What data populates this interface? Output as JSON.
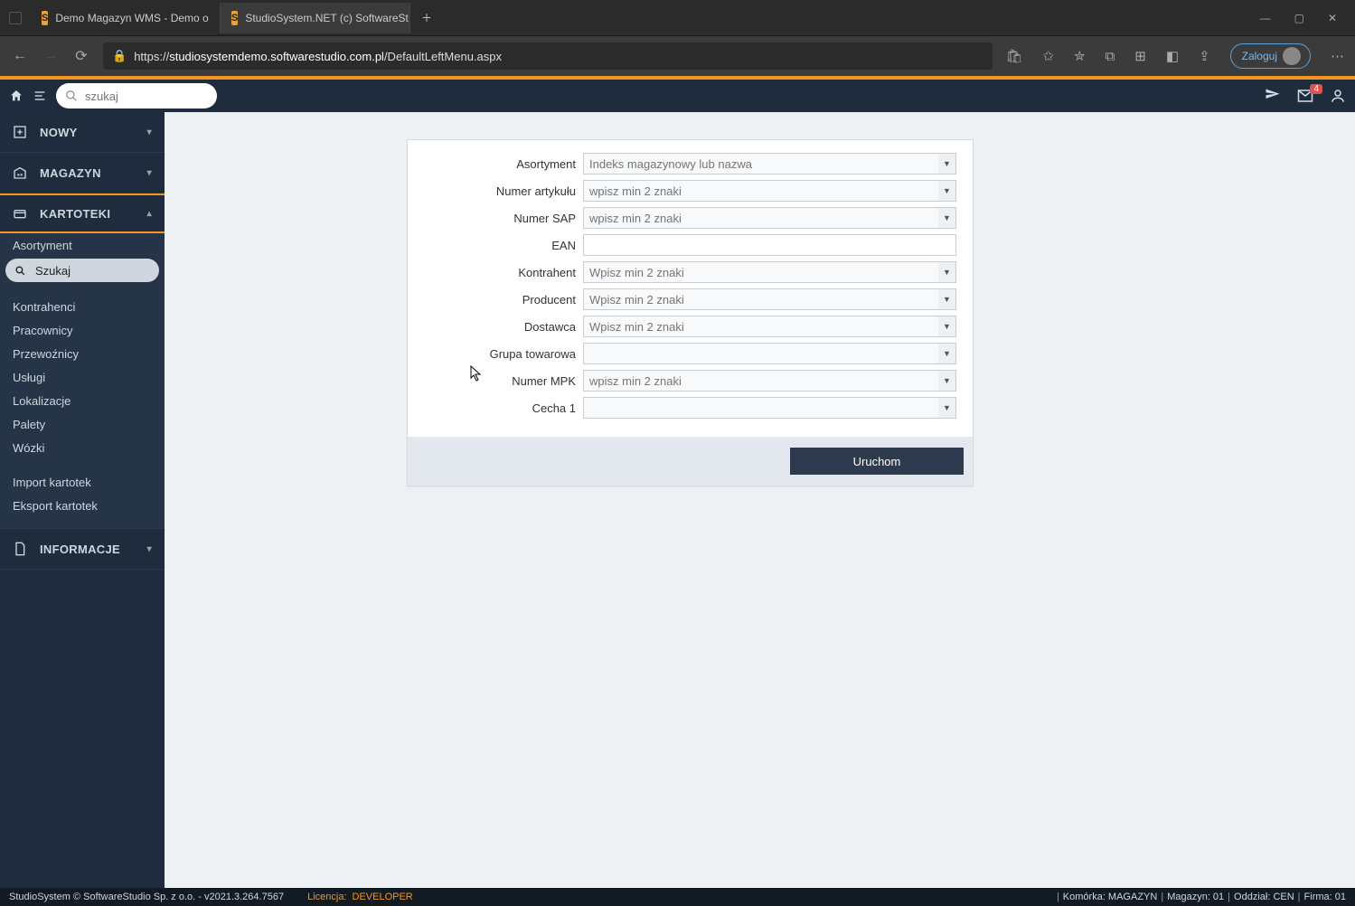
{
  "browser": {
    "tabs": [
      {
        "title": "Demo Magazyn WMS - Demo o"
      },
      {
        "title": "StudioSystem.NET (c) SoftwareSt"
      }
    ],
    "url_prefix": "https://",
    "url_domain": "studiosystemdemo.softwarestudio.com.pl",
    "url_path": "/DefaultLeftMenu.aspx",
    "login_label": "Zaloguj"
  },
  "header": {
    "search_placeholder": "szukaj",
    "notification_count": "4"
  },
  "sidebar": {
    "sections": {
      "nowy": "NOWY",
      "magazyn": "MAGAZYN",
      "kartoteki": "KARTOTEKI",
      "informacje": "INFORMACJE"
    },
    "kartoteki_items": {
      "asortyment": "Asortyment",
      "szukaj": "Szukaj",
      "kontrahenci": "Kontrahenci",
      "pracownicy": "Pracownicy",
      "przewoznicy": "Przewoźnicy",
      "uslugi": "Usługi",
      "lokalizacje": "Lokalizacje",
      "palety": "Palety",
      "wozki": "Wózki",
      "import": "Import kartotek",
      "eksport": "Eksport kartotek"
    }
  },
  "form": {
    "labels": {
      "asortyment": "Asortyment",
      "numer_artykulu": "Numer artykułu",
      "numer_sap": "Numer SAP",
      "ean": "EAN",
      "kontrahent": "Kontrahent",
      "producent": "Producent",
      "dostawca": "Dostawca",
      "grupa": "Grupa towarowa",
      "numer_mpk": "Numer MPK",
      "cecha1": "Cecha 1"
    },
    "placeholders": {
      "asortyment": "Indeks magazynowy lub nazwa",
      "min2": "wpisz min 2 znaki",
      "min2cap": "Wpisz min 2 znaki",
      "empty": ""
    },
    "run_button": "Uruchom"
  },
  "status": {
    "copyright": "StudioSystem © SoftwareStudio Sp. z o.o. - v2021.3.264.7567",
    "license_label": "Licencja:",
    "license_value": "DEVELOPER",
    "komorka": "Komórka: MAGAZYN",
    "magazyn": "Magazyn: 01",
    "oddzial": "Oddział: CEN",
    "firma": "Firma: 01"
  }
}
